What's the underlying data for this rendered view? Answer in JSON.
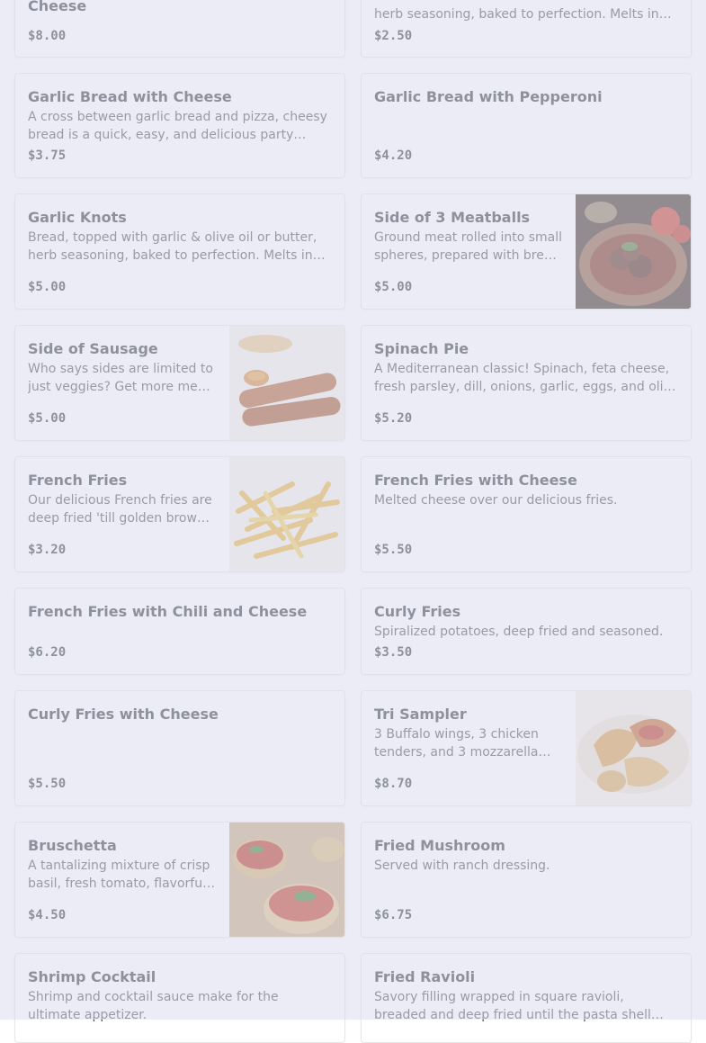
{
  "menu": {
    "items": [
      {
        "id": "cheese-bread-partial",
        "title": "Cheese",
        "desc": "",
        "price": "$8.00"
      },
      {
        "id": "garlic-knots-partial",
        "title": "",
        "desc": "herb seasoning, baked to perfection. Melts in…",
        "price": "$2.50"
      },
      {
        "id": "garlic-bread-cheese",
        "title": "Garlic Bread with Cheese",
        "desc": "A cross between garlic bread and pizza, cheesy bread is a quick, easy, and delicious party…",
        "price": "$3.75"
      },
      {
        "id": "garlic-bread-pepperoni",
        "title": "Garlic Bread with Pepperoni",
        "desc": "",
        "price": "$4.20"
      },
      {
        "id": "garlic-knots",
        "title": "Garlic Knots",
        "desc": "Bread, topped with garlic & olive oil or butter, herb seasoning, baked to perfection. Melts in…",
        "price": "$5.00"
      },
      {
        "id": "side-meatballs",
        "title": "Side of 3 Meatballs",
        "desc": "Ground meat rolled into small spheres, prepared with bre…",
        "price": "$5.00",
        "image": "meatballs"
      },
      {
        "id": "side-sausage",
        "title": "Side of Sausage",
        "desc": "Who says sides are limited to just veggies? Get more me…",
        "price": "$5.00",
        "image": "sausage"
      },
      {
        "id": "spinach-pie",
        "title": "Spinach Pie",
        "desc": "A Mediterranean classic! Spinach, feta cheese, fresh parsley, dill, onions, garlic, eggs, and oli…",
        "price": "$5.20"
      },
      {
        "id": "french-fries",
        "title": "French Fries",
        "desc": "Our delicious French fries are deep fried 'till golden brow…",
        "price": "$3.20",
        "image": "fries"
      },
      {
        "id": "french-fries-cheese",
        "title": "French Fries with Cheese",
        "desc": "Melted cheese over our delicious fries.",
        "price": "$5.50"
      },
      {
        "id": "fries-chili-cheese",
        "title": "French Fries with Chili and Cheese",
        "desc": "",
        "price": "$6.20"
      },
      {
        "id": "curly-fries",
        "title": "Curly Fries",
        "desc": "Spiralized potatoes, deep fried and seasoned.",
        "price": "$3.50"
      },
      {
        "id": "curly-fries-cheese",
        "title": "Curly Fries with Cheese",
        "desc": "",
        "price": "$5.50"
      },
      {
        "id": "tri-sampler",
        "title": "Tri Sampler",
        "desc": "3 Buffalo wings, 3 chicken tenders, and 3 mozzarella…",
        "price": "$8.70",
        "image": "sampler"
      },
      {
        "id": "bruschetta",
        "title": "Bruschetta",
        "desc": "A tantalizing mixture of crisp basil, fresh tomato, flavorfu…",
        "price": "$4.50",
        "image": "bruschetta"
      },
      {
        "id": "fried-mushroom",
        "title": "Fried Mushroom",
        "desc": "Served with ranch dressing.",
        "price": "$6.75"
      },
      {
        "id": "shrimp-cocktail",
        "title": "Shrimp Cocktail",
        "desc": "Shrimp and cocktail sauce make for the ultimate appetizer.",
        "price": ""
      },
      {
        "id": "fried-ravioli",
        "title": "Fried Ravioli",
        "desc": "Savory filling wrapped in square ravioli, breaded and deep fried until the pasta shell…",
        "price": ""
      }
    ]
  },
  "theme": {
    "overlay": "#dadcec",
    "text": "#33343d",
    "border": "#e6e6ea"
  }
}
